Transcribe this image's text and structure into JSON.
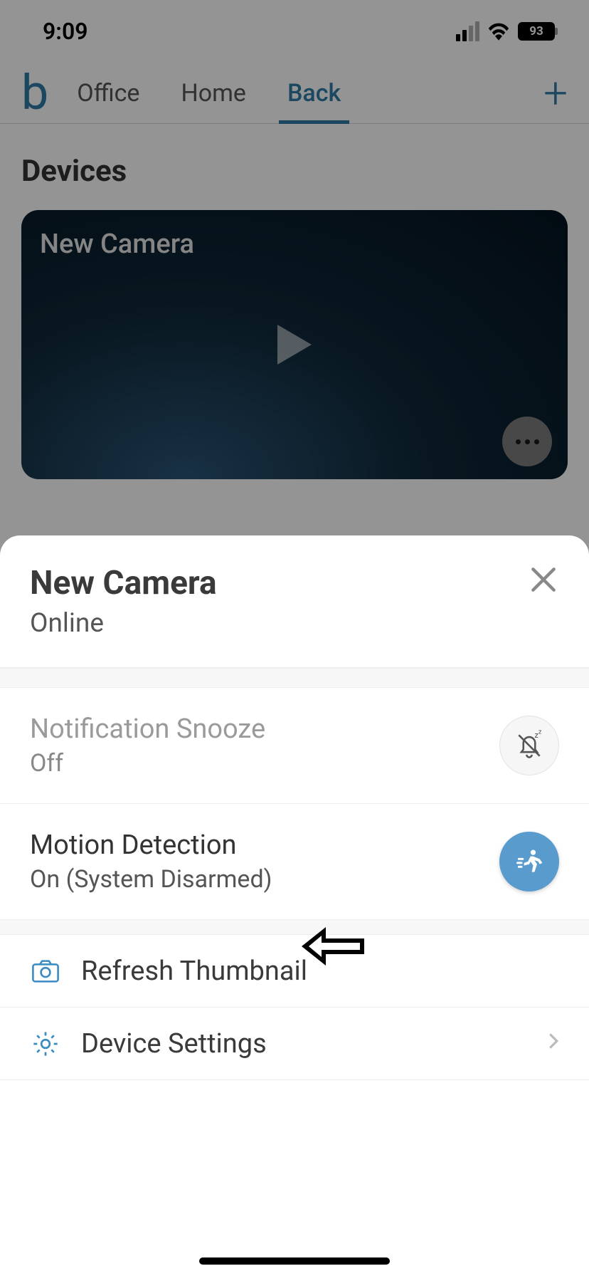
{
  "status": {
    "time": "9:09",
    "battery": "93"
  },
  "header": {
    "logo": "b",
    "tabs": [
      {
        "label": "Office",
        "active": false
      },
      {
        "label": "Home",
        "active": false
      },
      {
        "label": "Back",
        "active": true
      }
    ]
  },
  "section": {
    "title": "Devices"
  },
  "camera": {
    "name": "New Camera"
  },
  "sheet": {
    "title": "New Camera",
    "status": "Online",
    "snooze": {
      "title": "Notification Snooze",
      "value": "Off"
    },
    "motion": {
      "title": "Motion Detection",
      "value": "On (System Disarmed)"
    },
    "refresh": "Refresh Thumbnail",
    "settings": "Device Settings"
  }
}
